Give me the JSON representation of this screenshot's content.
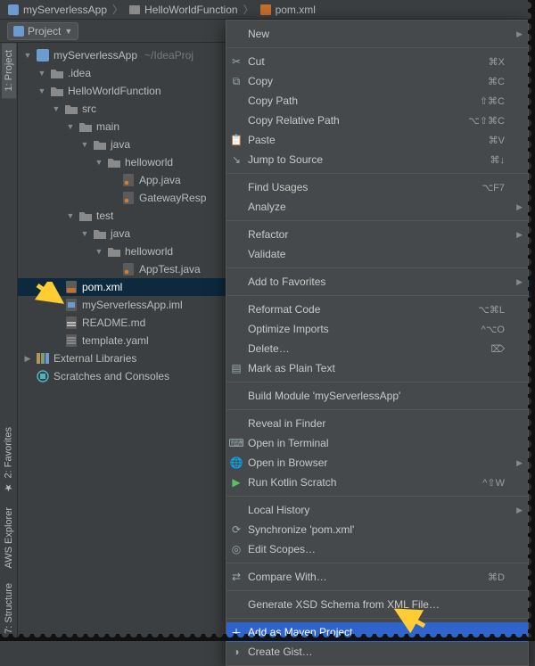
{
  "breadcrumbs": [
    {
      "icon": "project-icon",
      "label": "myServerlessApp"
    },
    {
      "icon": "folder-icon",
      "label": "HelloWorldFunction"
    },
    {
      "icon": "xml-file-icon",
      "label": "pom.xml"
    }
  ],
  "toolbar": {
    "project_label": "Project"
  },
  "gutter": {
    "tabs": [
      {
        "label": "1: Project",
        "active": true
      },
      {
        "label": "2: Favorites",
        "active": false
      },
      {
        "label": "AWS Explorer",
        "active": false
      },
      {
        "label": "7: Structure",
        "active": false
      }
    ]
  },
  "tree": {
    "nodes": [
      {
        "depth": 0,
        "expanded": true,
        "icon": "project-icon",
        "label": "myServerlessApp",
        "hint": "~/IdeaProj"
      },
      {
        "depth": 1,
        "expanded": true,
        "icon": "folder-icon",
        "label": ".idea"
      },
      {
        "depth": 1,
        "expanded": true,
        "icon": "folder-icon",
        "label": "HelloWorldFunction"
      },
      {
        "depth": 2,
        "expanded": true,
        "icon": "folder-icon",
        "label": "src"
      },
      {
        "depth": 3,
        "expanded": true,
        "icon": "folder-icon",
        "label": "main"
      },
      {
        "depth": 4,
        "expanded": true,
        "icon": "folder-icon",
        "label": "java"
      },
      {
        "depth": 5,
        "expanded": true,
        "icon": "folder-icon",
        "label": "helloworld"
      },
      {
        "depth": 6,
        "expanded": null,
        "icon": "java-file-icon",
        "label": "App.java"
      },
      {
        "depth": 6,
        "expanded": null,
        "icon": "java-file-icon",
        "label": "GatewayResp"
      },
      {
        "depth": 3,
        "expanded": true,
        "icon": "folder-icon",
        "label": "test"
      },
      {
        "depth": 4,
        "expanded": true,
        "icon": "folder-icon",
        "label": "java"
      },
      {
        "depth": 5,
        "expanded": true,
        "icon": "folder-icon",
        "label": "helloworld"
      },
      {
        "depth": 6,
        "expanded": null,
        "icon": "java-file-icon",
        "label": "AppTest.java"
      },
      {
        "depth": 2,
        "expanded": null,
        "icon": "xml-file-icon",
        "label": "pom.xml",
        "selected": true
      },
      {
        "depth": 2,
        "expanded": null,
        "icon": "iml-file-icon",
        "label": "myServerlessApp.iml"
      },
      {
        "depth": 2,
        "expanded": null,
        "icon": "md-file-icon",
        "label": "README.md"
      },
      {
        "depth": 2,
        "expanded": null,
        "icon": "yaml-file-icon",
        "label": "template.yaml"
      },
      {
        "depth": 0,
        "expanded": false,
        "icon": "lib-icon",
        "label": "External Libraries"
      },
      {
        "depth": 0,
        "expanded": null,
        "icon": "scratch-icon",
        "label": "Scratches and Consoles"
      }
    ]
  },
  "context_menu": {
    "groups": [
      [
        {
          "label": "New",
          "submenu": true
        }
      ],
      [
        {
          "icon": "cut-icon",
          "label": "Cut",
          "shortcut": "⌘X"
        },
        {
          "icon": "copy-icon",
          "label": "Copy",
          "shortcut": "⌘C"
        },
        {
          "label": "Copy Path",
          "shortcut": "⇧⌘C"
        },
        {
          "label": "Copy Relative Path",
          "shortcut": "⌥⇧⌘C"
        },
        {
          "icon": "paste-icon",
          "label": "Paste",
          "shortcut": "⌘V"
        },
        {
          "icon": "jump-icon",
          "label": "Jump to Source",
          "shortcut": "⌘↓"
        }
      ],
      [
        {
          "label": "Find Usages",
          "shortcut": "⌥F7"
        },
        {
          "label": "Analyze",
          "submenu": true
        }
      ],
      [
        {
          "label": "Refactor",
          "submenu": true
        },
        {
          "label": "Validate"
        }
      ],
      [
        {
          "label": "Add to Favorites",
          "submenu": true
        }
      ],
      [
        {
          "label": "Reformat Code",
          "shortcut": "⌥⌘L"
        },
        {
          "label": "Optimize Imports",
          "shortcut": "^⌥O"
        },
        {
          "label": "Delete…",
          "shortcut": "⌦"
        },
        {
          "icon": "text-icon",
          "label": "Mark as Plain Text"
        }
      ],
      [
        {
          "label": "Build Module 'myServerlessApp'"
        }
      ],
      [
        {
          "label": "Reveal in Finder"
        },
        {
          "icon": "terminal-icon",
          "label": "Open in Terminal"
        },
        {
          "icon": "browser-icon",
          "label": "Open in Browser",
          "submenu": true
        },
        {
          "icon": "run-icon",
          "label": "Run Kotlin Scratch",
          "shortcut": "^⇧W"
        }
      ],
      [
        {
          "label": "Local History",
          "submenu": true
        },
        {
          "icon": "sync-icon",
          "label": "Synchronize 'pom.xml'"
        },
        {
          "icon": "scopes-icon",
          "label": "Edit Scopes…"
        }
      ],
      [
        {
          "icon": "diff-icon",
          "label": "Compare With…",
          "shortcut": "⌘D"
        }
      ],
      [
        {
          "label": "Generate XSD Schema from XML File…"
        }
      ],
      [
        {
          "icon": "plus-icon",
          "label": "Add as Maven Project",
          "highlight": true
        },
        {
          "icon": "github-icon",
          "label": "Create Gist…"
        }
      ]
    ]
  },
  "annotations": {
    "arrow_color": "#ffcc33"
  }
}
